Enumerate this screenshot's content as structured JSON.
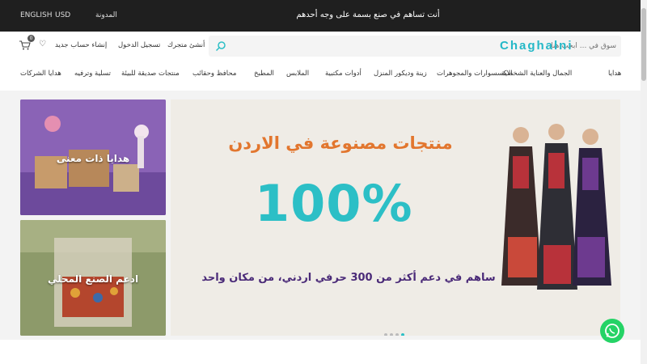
{
  "topbar": {
    "language": "ENGLISH",
    "currency": "USD",
    "blog": "المدونة",
    "promo": "أنت تساهم في صنع بسمة على وجه أحدهم"
  },
  "header": {
    "cart_count": "0",
    "register": "إنشاء حساب جديد",
    "login": "تسجيل الدخول",
    "store": "أنشئ متجرك",
    "search_placeholder": "سوق في ... ابحث هنا",
    "brand": "Chaghalni",
    "brand_ar": "سوق في"
  },
  "nav": {
    "items": [
      "هدايا",
      "الجمال والعناية الشخصية",
      "الاكسسوارات والمجوهرات",
      "زينة وديكور المنزل",
      "أدوات مكتبية",
      "الملابس",
      "المطبخ",
      "محافظ وحقائب",
      "منتجات صديقة للبيئة",
      "تسلية وترفيه",
      "هدايا الشركات"
    ]
  },
  "cards": {
    "gifts": "هدايا ذات معنى",
    "local": "ادعم الصنع المحلي"
  },
  "banner": {
    "title": "منتجات مصنوعة في الاردن",
    "percent": "100%",
    "subtitle": "ساهم في دعم أكثر من 300 حرفي اردني، من مكان واحد",
    "slides": 4,
    "active_slide": 4
  },
  "colors": {
    "accent": "#2cbfc6",
    "title_orange": "#e2762e",
    "subtitle_purple": "#4a2a78",
    "topbar": "#1f1f1f"
  }
}
